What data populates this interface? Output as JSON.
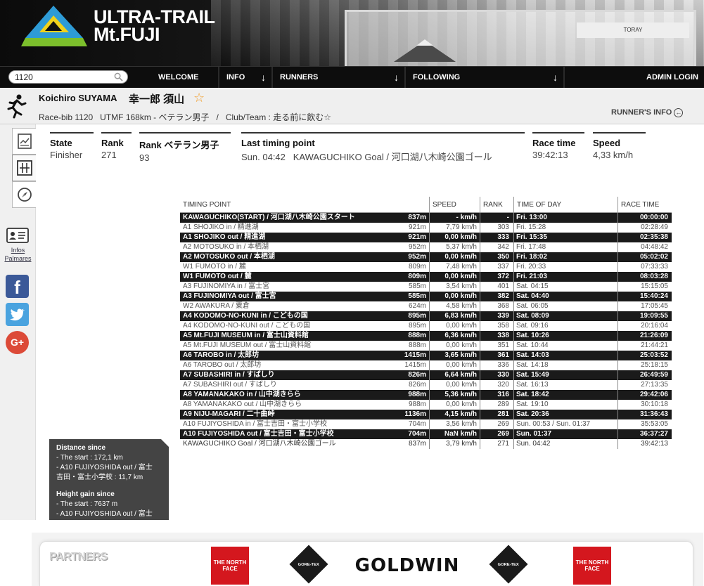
{
  "brand": {
    "title_line1": "ULTRA-TRAIL",
    "title_line2": "Mt.FUJI"
  },
  "header_banner": {
    "text": "TORAY"
  },
  "nav": {
    "search_value": "1120",
    "items": [
      {
        "label": "WELCOME",
        "arrow": ""
      },
      {
        "label": "INFO",
        "arrow": "↓"
      },
      {
        "label": "RUNNERS",
        "arrow": "↓"
      },
      {
        "label": "FOLLOWING",
        "arrow": "↓"
      },
      {
        "label": "ADMIN LOGIN",
        "arrow": ""
      }
    ]
  },
  "runner": {
    "name": "Koichiro SUYAMA",
    "name_kanji": "幸一郎 須山",
    "subtitle": "Race-bib 1120   UTMF 168km - ベテラン男子   /   Club/Team : 走る前に飲む☆",
    "info_link": "RUNNER'S INFO",
    "info_link_icon": "←"
  },
  "sidebar": {
    "infos_label": "Infos",
    "palmares_label": "Palmares",
    "facebook": "f",
    "twitter": "t",
    "google": "G+"
  },
  "stats": [
    {
      "label": "State",
      "value": "Finisher"
    },
    {
      "label": "Rank",
      "value": "271"
    },
    {
      "label": "Rank ベテラン男子",
      "value": "93"
    },
    {
      "label": "Last timing point",
      "value": "Sun. 04:42   KAWAGUCHIKO Goal / 河口湖八木崎公園ゴール"
    },
    {
      "label": "Race time",
      "value": "39:42:13"
    },
    {
      "label": "Speed",
      "value": "4,33 km/h"
    }
  ],
  "table": {
    "headers": {
      "point": "TIMING POINT",
      "speed": "SPEED",
      "rank": "RANK",
      "time": "TIME OF DAY",
      "race": "RACE TIME"
    },
    "rows": [
      {
        "style": "dark",
        "point": "KAWAGUCHIKO(START) / 河口湖八木崎公園スタート",
        "dist": "837m",
        "speed": "- km/h",
        "rank": "-",
        "time": "Fri. 13:00",
        "race": "00:00:00"
      },
      {
        "style": "light",
        "point": "A1 SHOJIKO in / 精進湖",
        "dist": "921m",
        "speed": "7,79 km/h",
        "rank": "303",
        "time": "Fri. 15:28",
        "race": "02:28:49"
      },
      {
        "style": "dark",
        "point": "A1 SHOJIKO out / 精進湖",
        "dist": "921m",
        "speed": "0,00 km/h",
        "rank": "333",
        "time": "Fri. 15:35",
        "race": "02:35:38"
      },
      {
        "style": "light",
        "point": "A2 MOTOSUKO in / 本栖湖",
        "dist": "952m",
        "speed": "5,37 km/h",
        "rank": "342",
        "time": "Fri. 17:48",
        "race": "04:48:42"
      },
      {
        "style": "dark",
        "point": "A2 MOTOSUKO out / 本栖湖",
        "dist": "952m",
        "speed": "0,00 km/h",
        "rank": "350",
        "time": "Fri. 18:02",
        "race": "05:02:02"
      },
      {
        "style": "light",
        "point": "W1 FUMOTO in / 麓",
        "dist": "809m",
        "speed": "7,48 km/h",
        "rank": "337",
        "time": "Fri. 20:33",
        "race": "07:33:33"
      },
      {
        "style": "dark",
        "point": "W1 FUMOTO out / 麓",
        "dist": "809m",
        "speed": "0,00 km/h",
        "rank": "372",
        "time": "Fri. 21:03",
        "race": "08:03:28"
      },
      {
        "style": "light",
        "point": "A3 FUJINOMIYA in / 富士宮",
        "dist": "585m",
        "speed": "3,54 km/h",
        "rank": "401",
        "time": "Sat. 04:15",
        "race": "15:15:05"
      },
      {
        "style": "dark",
        "point": "A3 FUJINOMIYA out / 富士宮",
        "dist": "585m",
        "speed": "0,00 km/h",
        "rank": "382",
        "time": "Sat. 04:40",
        "race": "15:40:24"
      },
      {
        "style": "light",
        "point": "W2 AWAKURA / 粟倉",
        "dist": "624m",
        "speed": "4,58 km/h",
        "rank": "368",
        "time": "Sat. 06:05",
        "race": "17:05:45"
      },
      {
        "style": "dark",
        "point": "A4 KODOMO-NO-KUNI in / こどもの国",
        "dist": "895m",
        "speed": "6,83 km/h",
        "rank": "339",
        "time": "Sat. 08:09",
        "race": "19:09:55"
      },
      {
        "style": "light",
        "point": "A4 KODOMO-NO-KUNI out / こどもの国",
        "dist": "895m",
        "speed": "0,00 km/h",
        "rank": "358",
        "time": "Sat. 09:16",
        "race": "20:16:04"
      },
      {
        "style": "dark",
        "point": "A5 Mt.FUJI MUSEUM in / 富士山資料館",
        "dist": "888m",
        "speed": "6,36 km/h",
        "rank": "338",
        "time": "Sat. 10:26",
        "race": "21:26:09"
      },
      {
        "style": "light",
        "point": "A5 Mt.FUJI MUSEUM out / 富士山資料館",
        "dist": "888m",
        "speed": "0,00 km/h",
        "rank": "351",
        "time": "Sat. 10:44",
        "race": "21:44:21"
      },
      {
        "style": "dark",
        "point": "A6 TAROBO in / 太郎坊",
        "dist": "1415m",
        "speed": "3,65 km/h",
        "rank": "361",
        "time": "Sat. 14:03",
        "race": "25:03:52"
      },
      {
        "style": "light",
        "point": "A6 TAROBO out / 太郎坊",
        "dist": "1415m",
        "speed": "0,00 km/h",
        "rank": "336",
        "time": "Sat. 14:18",
        "race": "25:18:15"
      },
      {
        "style": "dark",
        "point": "A7 SUBASHIRI in / すばしり",
        "dist": "826m",
        "speed": "6,64 km/h",
        "rank": "330",
        "time": "Sat. 15:49",
        "race": "26:49:59"
      },
      {
        "style": "light",
        "point": "A7 SUBASHIRI out / すばしり",
        "dist": "826m",
        "speed": "0,00 km/h",
        "rank": "320",
        "time": "Sat. 16:13",
        "race": "27:13:35"
      },
      {
        "style": "dark",
        "point": "A8 YAMANAKAKO in / 山中湖きらら",
        "dist": "988m",
        "speed": "5,36 km/h",
        "rank": "316",
        "time": "Sat. 18:42",
        "race": "29:42:06"
      },
      {
        "style": "light",
        "point": "A8 YAMANAKAKO out / 山中湖きらら",
        "dist": "988m",
        "speed": "0,00 km/h",
        "rank": "289",
        "time": "Sat. 19:10",
        "race": "30:10:18"
      },
      {
        "style": "dark",
        "point": "A9 NIJU-MAGARI / 二十曲峠",
        "dist": "1136m",
        "speed": "4,15 km/h",
        "rank": "281",
        "time": "Sat. 20:36",
        "race": "31:36:43"
      },
      {
        "style": "light",
        "point": "A10 FUJIYOSHIDA in / 富士吉田・富士小学校",
        "dist": "704m",
        "speed": "3,56 km/h",
        "rank": "269",
        "time": "Sun. 00:53 / Sun. 01:37",
        "race": "35:53:05"
      },
      {
        "style": "dark",
        "point": "A10 FUJIYOSHIDA out / 富士吉田・富士小学校",
        "dist": "704m",
        "speed": "NaN km/h",
        "rank": "269",
        "time": "Sun. 01:37",
        "race": "36:37:27"
      },
      {
        "style": "goal",
        "point": "KAWAGUCHIKO Goal / 河口湖八木崎公園ゴール",
        "dist": "837m",
        "speed": "3,79 km/h",
        "rank": "271",
        "time": "Sun. 04:42",
        "race": "39:42:13"
      }
    ]
  },
  "distance_box": {
    "title1": "Distance since",
    "l1": "- The start : 172,1 km",
    "l2": "- A10 FUJIYOSHIDA out / 富士",
    "l3": "吉田・富士小学校 : 11,7 km",
    "title2": "Height gain since",
    "l4": "- The start : 7637 m",
    "l5": "- A10 FUJIYOSHIDA out / 富士"
  },
  "partners": {
    "title": "PARTNERS",
    "tnf_text": "THE NORTH FACE",
    "goretex_text": "GORE-TEX",
    "goldwin_text": "GOLDWIN"
  }
}
